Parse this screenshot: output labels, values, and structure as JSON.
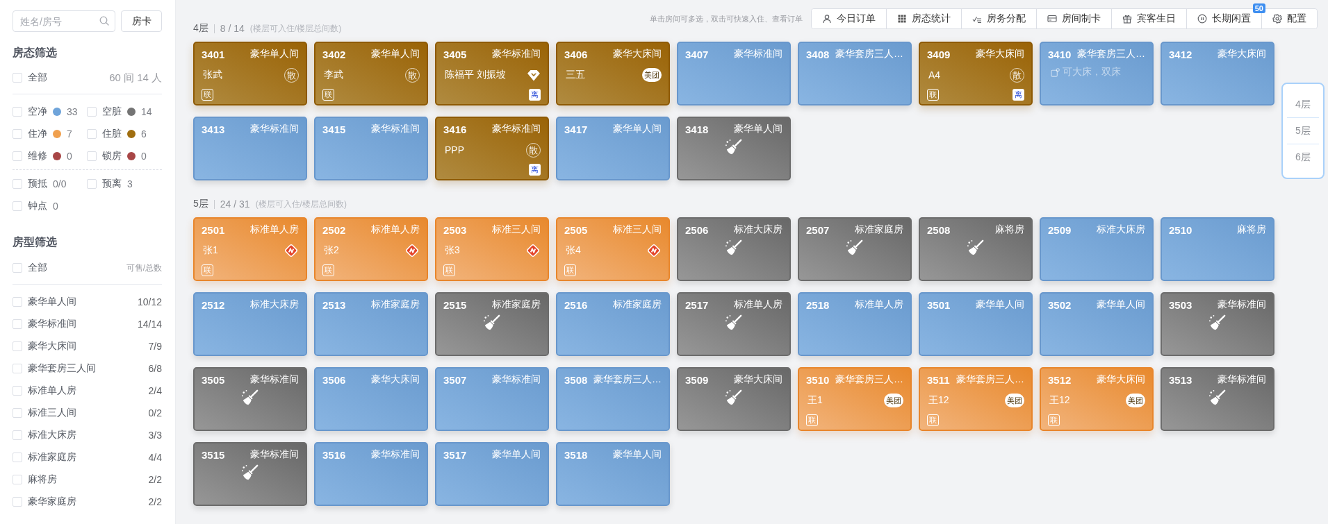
{
  "sidebar": {
    "search": {
      "placeholder": "姓名/房号"
    },
    "card_button": "房卡",
    "status_filter": {
      "title": "房态筛选",
      "all": {
        "label": "全部",
        "checked": false,
        "summary": "60 间 14 人"
      },
      "statuses": [
        {
          "label": "空净",
          "color": "#6fa4da",
          "count": "33",
          "checked": false
        },
        {
          "label": "空脏",
          "color": "#747474",
          "count": "14",
          "checked": false
        },
        {
          "label": "住净",
          "color": "#f0a04e",
          "count": "7",
          "checked": false
        },
        {
          "label": "住脏",
          "color": "#a06e10",
          "count": "6",
          "checked": false
        },
        {
          "label": "维修",
          "color": "#a84646",
          "count": "0",
          "checked": false
        },
        {
          "label": "锁房",
          "color": "#a84646",
          "count": "0",
          "checked": false
        }
      ],
      "extras": [
        {
          "label": "预抵",
          "count": "0/0",
          "checked": false
        },
        {
          "label": "预离",
          "count": "3",
          "checked": false
        },
        {
          "label": "钟点",
          "count": "0",
          "checked": false
        }
      ]
    },
    "type_filter": {
      "title": "房型筛选",
      "all": {
        "label": "全部",
        "checked": false,
        "header": "可售/总数"
      },
      "types": [
        {
          "label": "豪华单人间",
          "count": "10/12",
          "checked": false
        },
        {
          "label": "豪华标准间",
          "count": "14/14",
          "checked": false
        },
        {
          "label": "豪华大床间",
          "count": "7/9",
          "checked": false
        },
        {
          "label": "豪华套房三人间",
          "count": "6/8",
          "checked": false
        },
        {
          "label": "标准单人房",
          "count": "2/4",
          "checked": false
        },
        {
          "label": "标准三人间",
          "count": "0/2",
          "checked": false
        },
        {
          "label": "标准大床房",
          "count": "3/3",
          "checked": false
        },
        {
          "label": "标准家庭房",
          "count": "4/4",
          "checked": false
        },
        {
          "label": "麻将房",
          "count": "2/2",
          "checked": false
        },
        {
          "label": "豪华家庭房",
          "count": "2/2",
          "checked": false
        }
      ]
    }
  },
  "hint": "单击房间可多选，双击可快速入住、查看订单",
  "toolbar": [
    {
      "label": "今日订单"
    },
    {
      "label": "房态统计"
    },
    {
      "label": "房务分配"
    },
    {
      "label": "房间制卡"
    },
    {
      "label": "宾客生日"
    },
    {
      "label": "长期闲置",
      "badge": "50"
    },
    {
      "label": "配置"
    }
  ],
  "floors": [
    {
      "label": "4层",
      "count": "8 / 14",
      "note": "(楼层可入住/楼层总间数)",
      "rooms": [
        {
          "number": "3401",
          "type": "豪华单人间",
          "occupied": true,
          "clean": false,
          "guest": "张武",
          "source": {
            "kind": "walk_in",
            "label": "散"
          },
          "linked": "联"
        },
        {
          "number": "3402",
          "type": "豪华单人间",
          "occupied": true,
          "clean": false,
          "guest": "李武",
          "source": {
            "kind": "walk_in",
            "label": "散"
          },
          "linked": "联"
        },
        {
          "number": "3405",
          "type": "豪华标准间",
          "occupied": true,
          "clean": false,
          "guest": "陈福平 刘振坡",
          "source": {
            "kind": "vip"
          },
          "departing": "离"
        },
        {
          "number": "3406",
          "type": "豪华大床间",
          "occupied": true,
          "clean": false,
          "guest": "三五",
          "source": {
            "kind": "meituan",
            "label": "美团"
          }
        },
        {
          "number": "3407",
          "type": "豪华标准间",
          "occupied": false,
          "clean": true
        },
        {
          "number": "3408",
          "type": "豪华套房三人…",
          "occupied": false,
          "clean": true
        },
        {
          "number": "3409",
          "type": "豪华大床间",
          "occupied": true,
          "clean": false,
          "guest": "A4",
          "source": {
            "kind": "walk_in",
            "label": "散"
          },
          "linked": "联",
          "departing": "离"
        },
        {
          "number": "3410",
          "type": "豪华套房三人…",
          "occupied": false,
          "clean": true,
          "note": "可大床，双床"
        },
        {
          "number": "3412",
          "type": "豪华大床间",
          "occupied": false,
          "clean": true
        },
        {
          "number": "3413",
          "type": "豪华标准间",
          "occupied": false,
          "clean": true
        },
        {
          "number": "3415",
          "type": "豪华标准间",
          "occupied": false,
          "clean": true
        },
        {
          "number": "3416",
          "type": "豪华标准间",
          "occupied": true,
          "clean": false,
          "guest": "PPP",
          "source": {
            "kind": "walk_in",
            "label": "散"
          },
          "departing": "离"
        },
        {
          "number": "3417",
          "type": "豪华单人间",
          "occupied": false,
          "clean": true
        },
        {
          "number": "3418",
          "type": "豪华单人间",
          "occupied": false,
          "clean": false
        }
      ]
    },
    {
      "label": "5层",
      "count": "24 / 31",
      "note": "(楼层可入住/楼层总间数)",
      "rooms": [
        {
          "number": "2501",
          "type": "标准单人房",
          "occupied": true,
          "clean": true,
          "guest": "张1",
          "source": {
            "kind": "ota"
          },
          "linked": "联"
        },
        {
          "number": "2502",
          "type": "标准单人房",
          "occupied": true,
          "clean": true,
          "guest": "张2",
          "source": {
            "kind": "ota"
          },
          "linked": "联"
        },
        {
          "number": "2503",
          "type": "标准三人间",
          "occupied": true,
          "clean": true,
          "guest": "张3",
          "source": {
            "kind": "ota"
          },
          "linked": "联"
        },
        {
          "number": "2505",
          "type": "标准三人间",
          "occupied": true,
          "clean": true,
          "guest": "张4",
          "source": {
            "kind": "ota"
          },
          "linked": "联"
        },
        {
          "number": "2506",
          "type": "标准大床房",
          "occupied": false,
          "clean": false
        },
        {
          "number": "2507",
          "type": "标准家庭房",
          "occupied": false,
          "clean": false
        },
        {
          "number": "2508",
          "type": "麻将房",
          "occupied": false,
          "clean": false
        },
        {
          "number": "2509",
          "type": "标准大床房",
          "occupied": false,
          "clean": true
        },
        {
          "number": "2510",
          "type": "麻将房",
          "occupied": false,
          "clean": true
        },
        {
          "number": "2512",
          "type": "标准大床房",
          "occupied": false,
          "clean": true
        },
        {
          "number": "2513",
          "type": "标准家庭房",
          "occupied": false,
          "clean": true
        },
        {
          "number": "2515",
          "type": "标准家庭房",
          "occupied": false,
          "clean": false
        },
        {
          "number": "2516",
          "type": "标准家庭房",
          "occupied": false,
          "clean": true
        },
        {
          "number": "2517",
          "type": "标准单人房",
          "occupied": false,
          "clean": false
        },
        {
          "number": "2518",
          "type": "标准单人房",
          "occupied": false,
          "clean": true
        },
        {
          "number": "3501",
          "type": "豪华单人间",
          "occupied": false,
          "clean": true
        },
        {
          "number": "3502",
          "type": "豪华单人间",
          "occupied": false,
          "clean": true
        },
        {
          "number": "3503",
          "type": "豪华标准间",
          "occupied": false,
          "clean": false
        },
        {
          "number": "3505",
          "type": "豪华标准间",
          "occupied": false,
          "clean": false
        },
        {
          "number": "3506",
          "type": "豪华大床间",
          "occupied": false,
          "clean": true
        },
        {
          "number": "3507",
          "type": "豪华标准间",
          "occupied": false,
          "clean": true
        },
        {
          "number": "3508",
          "type": "豪华套房三人…",
          "occupied": false,
          "clean": true
        },
        {
          "number": "3509",
          "type": "豪华大床间",
          "occupied": false,
          "clean": false
        },
        {
          "number": "3510",
          "type": "豪华套房三人…",
          "occupied": true,
          "clean": true,
          "guest": "王1",
          "source": {
            "kind": "meituan",
            "label": "美团"
          },
          "linked": "联"
        },
        {
          "number": "3511",
          "type": "豪华套房三人…",
          "occupied": true,
          "clean": true,
          "guest": "王12",
          "source": {
            "kind": "meituan",
            "label": "美团"
          },
          "linked": "联"
        },
        {
          "number": "3512",
          "type": "豪华大床间",
          "occupied": true,
          "clean": true,
          "guest": "王12",
          "source": {
            "kind": "meituan",
            "label": "美团"
          },
          "linked": "联"
        },
        {
          "number": "3513",
          "type": "豪华标准间",
          "occupied": false,
          "clean": false
        },
        {
          "number": "3515",
          "type": "豪华标准间",
          "occupied": false,
          "clean": false
        },
        {
          "number": "3516",
          "type": "豪华标准间",
          "occupied": false,
          "clean": true
        },
        {
          "number": "3517",
          "type": "豪华单人间",
          "occupied": false,
          "clean": true
        },
        {
          "number": "3518",
          "type": "豪华单人间",
          "occupied": false,
          "clean": true
        }
      ]
    }
  ],
  "floor_nav": [
    {
      "label": "4层",
      "selected": false
    },
    {
      "label": "5层",
      "selected": false
    },
    {
      "label": "6层",
      "selected": false
    }
  ]
}
